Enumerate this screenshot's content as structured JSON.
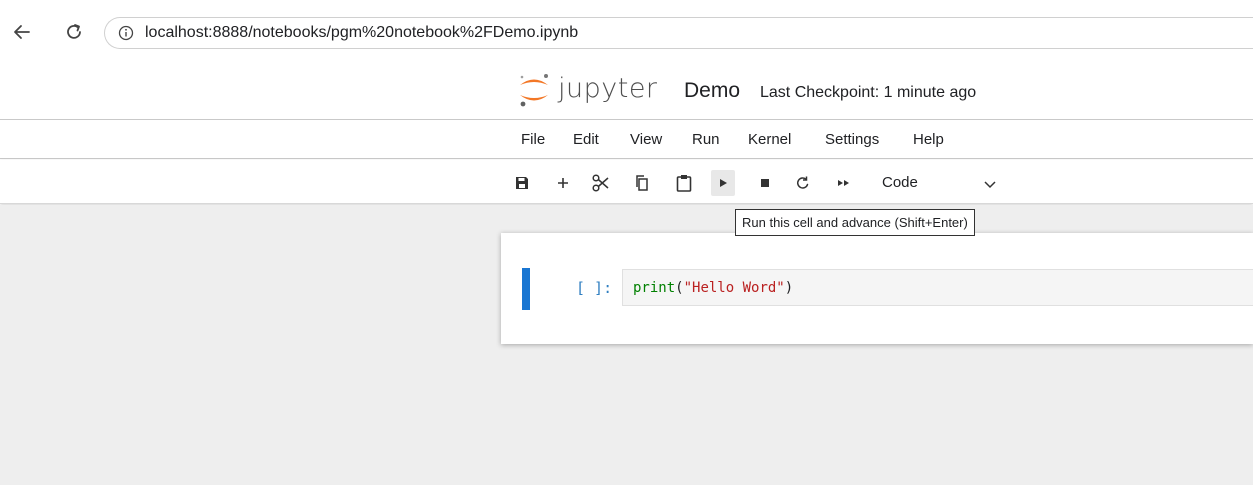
{
  "browser": {
    "url": "localhost:8888/notebooks/pgm%20notebook%2FDemo.ipynb"
  },
  "header": {
    "logo_text": "jupyter",
    "notebook_name": "Demo",
    "checkpoint": "Last Checkpoint: 1 minute ago"
  },
  "menu": {
    "items": [
      "File",
      "Edit",
      "View",
      "Run",
      "Kernel",
      "Settings",
      "Help"
    ]
  },
  "toolbar": {
    "icons": [
      "save-icon",
      "add-cell-icon",
      "cut-icon",
      "copy-icon",
      "paste-icon",
      "run-icon",
      "stop-icon",
      "restart-icon",
      "run-all-icon"
    ],
    "cell_type": "Code"
  },
  "tooltip": "Run this cell and advance (Shift+Enter)",
  "cell": {
    "prompt": "[ ]:",
    "code": {
      "fn": "print",
      "open": "(",
      "string": "\"Hello Word\"",
      "close": ")"
    }
  },
  "colors": {
    "accent": "#1976d2",
    "jupyter_orange": "#f37726",
    "prompt": "#307fc1",
    "builtin": "#008000",
    "string": "#ba2121"
  }
}
